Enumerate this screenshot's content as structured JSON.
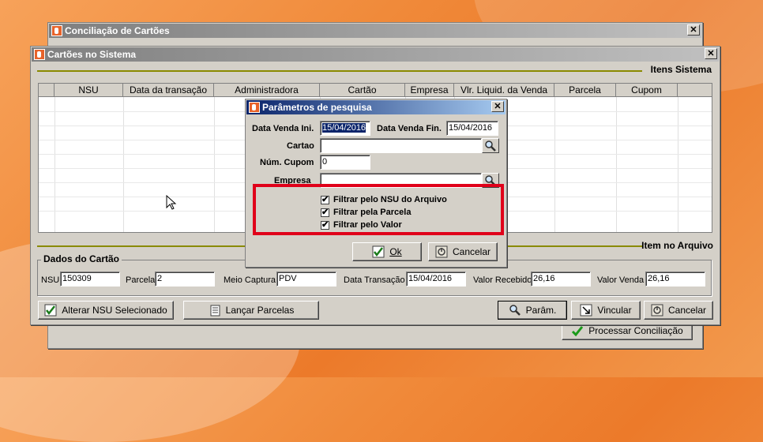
{
  "outer_window": {
    "title": "Conciliação de Cartões",
    "close": "✕",
    "process_button": "Processar Conciliação"
  },
  "main_window": {
    "title": "Cartões no Sistema",
    "close": "✕",
    "section_system": "Itens Sistema",
    "section_file": "Item no Arquivo",
    "grid_columns": [
      "NSU",
      "Data da transação",
      "Administradora",
      "Cartão",
      "Empresa",
      "Vlr. Liquid. da Venda",
      "Parcela",
      "Cupom"
    ],
    "card_group": {
      "title": "Dados do Cartão",
      "nsu_label": "NSU",
      "nsu_value": "150309",
      "parcela_label": "Parcela",
      "parcela_value": "2",
      "meio_label": "Meio Captura",
      "meio_value": "PDV",
      "data_label": "Data Transação",
      "data_value": "15/04/2016",
      "valor_recebido_label": "Valor Recebido",
      "valor_recebido_value": "26,16",
      "valor_venda_label": "Valor Venda",
      "valor_venda_value": "26,16"
    },
    "buttons": {
      "alterar": "Alterar NSU Selecionado",
      "lancar": "Lançar Parcelas",
      "param": "Parâm.",
      "vincular": "Vincular",
      "cancelar": "Cancelar"
    }
  },
  "dialog": {
    "title": "Parâmetros de pesquisa",
    "close": "✕",
    "data_ini_label": "Data Venda Ini.",
    "data_ini_value": "15/04/2016",
    "data_fin_label": "Data Venda Fin.",
    "data_fin_value": "15/04/2016",
    "cartao_label": "Cartao",
    "cartao_value": "",
    "cupom_label": "Núm. Cupom",
    "cupom_value": "0",
    "empresa_label": "Empresa",
    "empresa_value": "",
    "filters": [
      {
        "label": "Filtrar pelo NSU do Arquivo",
        "checked": true
      },
      {
        "label": "Filtrar pela Parcela",
        "checked": true
      },
      {
        "label": "Filtrar pelo Valor",
        "checked": true
      }
    ],
    "check_mark": "✔",
    "ok_label": "Ok",
    "cancel_label": "Cancelar"
  },
  "colors": {
    "highlight": "#e0001a",
    "desktop": "#ef8534",
    "active_title": "#0a246a"
  }
}
